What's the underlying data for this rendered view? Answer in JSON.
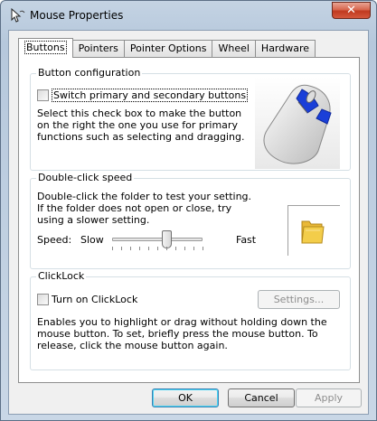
{
  "window": {
    "title": "Mouse Properties",
    "close_glyph": "✕"
  },
  "tabs": [
    {
      "label": "Buttons",
      "active": true
    },
    {
      "label": "Pointers"
    },
    {
      "label": "Pointer Options"
    },
    {
      "label": "Wheel"
    },
    {
      "label": "Hardware"
    }
  ],
  "button_config": {
    "title": "Button configuration",
    "checkbox_label": "Switch primary and secondary buttons",
    "checked": false,
    "description": "Select this check box to make the button on the right the one you use for primary functions such as selecting and dragging."
  },
  "double_click": {
    "title": "Double-click speed",
    "description": "Double-click the folder to test your setting. If the folder does not open or close, try using a slower setting.",
    "speed_label": "Speed:",
    "slow_label": "Slow",
    "fast_label": "Fast",
    "slider_value_fraction": 0.6
  },
  "clicklock": {
    "title": "ClickLock",
    "checkbox_label": "Turn on ClickLock",
    "checked": false,
    "settings_button": "Settings...",
    "description": "Enables you to highlight or drag without holding down the mouse button. To set, briefly press the mouse button. To release, click the mouse button again."
  },
  "footer": {
    "ok": "OK",
    "cancel": "Cancel",
    "apply": "Apply"
  },
  "colors": {
    "mouse_accent": "#1a3fd8",
    "folder": "#f3cd4a"
  },
  "icons": {
    "app": "mouse-pointer-icon",
    "mouse": "mouse-device-icon",
    "folder": "folder-icon"
  }
}
